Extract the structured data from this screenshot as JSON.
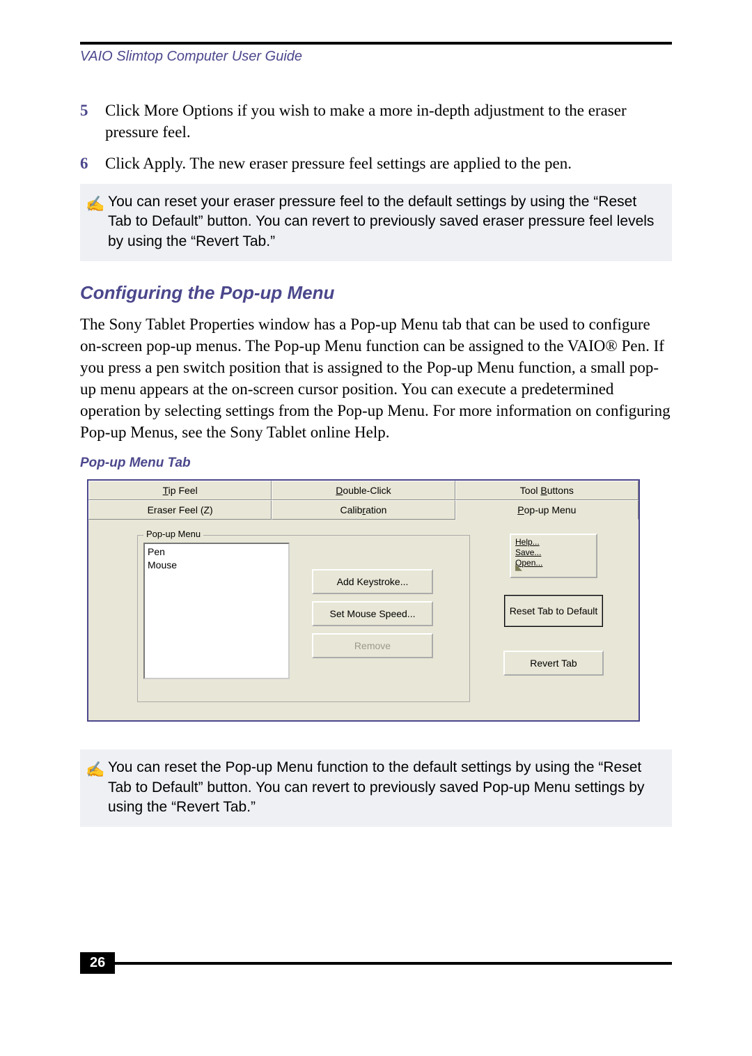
{
  "header": {
    "title": "VAIO Slimtop Computer User Guide"
  },
  "steps": [
    {
      "num": "5",
      "text": "Click More Options if you wish to make a more in-depth adjustment to the eraser pressure feel."
    },
    {
      "num": "6",
      "text": "Click Apply. The new eraser pressure feel settings are applied to the pen."
    }
  ],
  "note1": "You can reset your eraser pressure feel to the default settings by using the “Reset Tab to Default” button. You can revert to previously saved eraser pressure feel levels by using the “Revert Tab.”",
  "section_heading": "Configuring the Pop-up Menu",
  "section_body": "The Sony Tablet Properties window has a Pop-up Menu tab that can be used to configure on-screen pop-up menus. The Pop-up Menu function can be assigned to the VAIO® Pen. If you press a pen switch position that is assigned to the Pop-up Menu function, a small pop-up menu appears at the on-screen cursor position. You can execute a predetermined operation by selecting settings from the Pop-up Menu. For more information on configuring Pop-up Menus, see the Sony Tablet online Help.",
  "figure_caption": "Pop-up Menu Tab",
  "dialog": {
    "tabs_row1": [
      "Tip Feel",
      "Double-Click",
      "Tool Buttons"
    ],
    "tabs_row2": [
      "Eraser Feel (Z)",
      "Calibration",
      "Pop-up Menu"
    ],
    "active_tab": "Pop-up Menu",
    "fieldset_legend": "Pop-up Menu",
    "list_items": [
      "Pen",
      "Mouse"
    ],
    "buttons_center": [
      "Add Keystroke...",
      "Set Mouse Speed...",
      "Remove"
    ],
    "disabled_center": [
      "Remove"
    ],
    "preview_items": [
      "Help...",
      "Save...",
      "Open..."
    ],
    "buttons_right": [
      "Reset Tab to Default",
      "Revert Tab"
    ],
    "focus_right": "Reset Tab to Default"
  },
  "note2": "You can reset the Pop-up Menu function to the default settings by using the “Reset Tab to Default” button. You can revert to previously saved Pop-up Menu settings by using the “Revert Tab.”",
  "page_number": "26",
  "note_icon": "✍"
}
